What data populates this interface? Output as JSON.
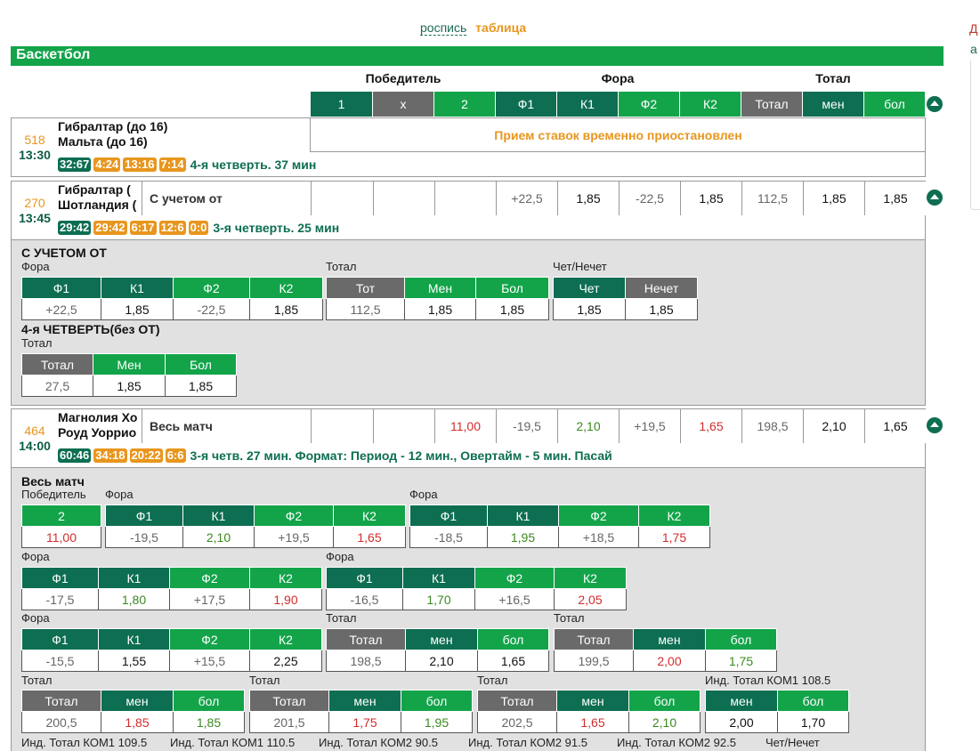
{
  "view_switch": {
    "list": "роспись",
    "table": "таблица"
  },
  "edge": {
    "t1": "Д",
    "t2": "а"
  },
  "sport": "Баскетбол",
  "groups": {
    "winner": "Победитель",
    "handicap": "Фора",
    "total": "Тотал"
  },
  "header_cols": [
    "1",
    "x",
    "2",
    "Ф1",
    "К1",
    "Ф2",
    "К2",
    "Тотал",
    "мен",
    "бол"
  ],
  "events": [
    {
      "num": "518",
      "time": "13:30",
      "team1": "Гибралтар (до 16)",
      "team2": "Мальта (до 16)",
      "scores": [
        "32:67",
        "4:24",
        "13:16",
        "7:14"
      ],
      "status": "4-я четверть. 37 мин",
      "suspended": "Прием ставок временно приостановлен"
    },
    {
      "num": "270",
      "time": "13:45",
      "team1": "Гибралтар (",
      "team2": "Шотландия (",
      "scores": [
        "29:42",
        "29:42",
        "6:17",
        "12:6",
        "0:0"
      ],
      "status": "3-я четверть. 25 мин",
      "market": "С учетом от",
      "odds": [
        "",
        "",
        "",
        "+22,5",
        "1,85",
        "-22,5",
        "1,85",
        "112,5",
        "1,85",
        "1,85"
      ]
    },
    {
      "num": "464",
      "time": "14:00",
      "team1": "Магнолия Хо",
      "team2": "Роуд Уоррио",
      "scores": [
        "60:46",
        "34:18",
        "20:22",
        "6:6"
      ],
      "status": "3-я четв. 27 мин. Формат: Период - 12 мин., Овертайм - 5 мин. Пасай",
      "market": "Весь матч",
      "odds": [
        "",
        "",
        "11,00",
        "-19,5",
        "2,10",
        "+19,5",
        "1,65",
        "198,5",
        "2,10",
        "1,65"
      ]
    }
  ],
  "panel1": {
    "title1": "С УЧЕТОМ ОТ",
    "fora_label": "Фора",
    "total_label": "Тотал",
    "chet_label": "Чет/Нечет",
    "fora": {
      "h": [
        "Ф1",
        "К1",
        "Ф2",
        "К2"
      ],
      "v": [
        "+22,5",
        "1,85",
        "-22,5",
        "1,85"
      ]
    },
    "total": {
      "h": [
        "Тот",
        "Мен",
        "Бол"
      ],
      "v": [
        "112,5",
        "1,85",
        "1,85"
      ]
    },
    "chet": {
      "h": [
        "Чет",
        "Нечет"
      ],
      "v": [
        "1,85",
        "1,85"
      ]
    },
    "title2": "4-я ЧЕТВЕРТЬ(без ОТ)",
    "total2_label": "Тотал",
    "total2": {
      "h": [
        "Тотал",
        "Мен",
        "Бол"
      ],
      "v": [
        "27,5",
        "1,85",
        "1,85"
      ]
    }
  },
  "panel2": {
    "title": "Весь матч",
    "labels": {
      "winner": "Победитель",
      "fora": "Фора",
      "total": "Тотал",
      "ind1_108": "Инд. Тотал КОМ1 108.5",
      "ind1_109": "Инд. Тотал КОМ1 109.5",
      "ind1_110": "Инд. Тотал КОМ1 110.5",
      "ind2_90": "Инд. Тотал КОМ2 90.5",
      "ind2_91": "Инд. Тотал КОМ2 91.5",
      "ind2_92": "Инд. Тотал КОМ2 92.5",
      "chet": "Чет/Нечет"
    },
    "winner": {
      "h": [
        "2"
      ],
      "v": [
        "11,00"
      ]
    },
    "fora1": {
      "h": [
        "Ф1",
        "К1",
        "Ф2",
        "К2"
      ],
      "v": [
        "-19,5",
        "2,10",
        "+19,5",
        "1,65"
      ]
    },
    "fora2": {
      "h": [
        "Ф1",
        "К1",
        "Ф2",
        "К2"
      ],
      "v": [
        "-18,5",
        "1,95",
        "+18,5",
        "1,75"
      ]
    },
    "fora3": {
      "h": [
        "Ф1",
        "К1",
        "Ф2",
        "К2"
      ],
      "v": [
        "-17,5",
        "1,80",
        "+17,5",
        "1,90"
      ]
    },
    "fora4": {
      "h": [
        "Ф1",
        "К1",
        "Ф2",
        "К2"
      ],
      "v": [
        "-16,5",
        "1,70",
        "+16,5",
        "2,05"
      ]
    },
    "fora5": {
      "h": [
        "Ф1",
        "К1",
        "Ф2",
        "К2"
      ],
      "v": [
        "-15,5",
        "1,55",
        "+15,5",
        "2,25"
      ]
    },
    "tot1": {
      "h": [
        "Тотал",
        "мен",
        "бол"
      ],
      "v": [
        "198,5",
        "2,10",
        "1,65"
      ]
    },
    "tot2": {
      "h": [
        "Тотал",
        "мен",
        "бол"
      ],
      "v": [
        "199,5",
        "2,00",
        "1,75"
      ]
    },
    "tot3": {
      "h": [
        "Тотал",
        "мен",
        "бол"
      ],
      "v": [
        "200,5",
        "1,85",
        "1,85"
      ]
    },
    "tot4": {
      "h": [
        "Тотал",
        "мен",
        "бол"
      ],
      "v": [
        "201,5",
        "1,75",
        "1,95"
      ]
    },
    "tot5": {
      "h": [
        "Тотал",
        "мен",
        "бол"
      ],
      "v": [
        "202,5",
        "1,65",
        "2,10"
      ]
    },
    "ind1": {
      "h": [
        "мен",
        "бол"
      ],
      "v": [
        "2,00",
        "1,70"
      ]
    }
  },
  "colors": {
    "dark": "#0d6e52",
    "green": "#13a44a",
    "gray": "#6a6a6a",
    "orange": "#e8961e",
    "red": "#d42b2b"
  }
}
